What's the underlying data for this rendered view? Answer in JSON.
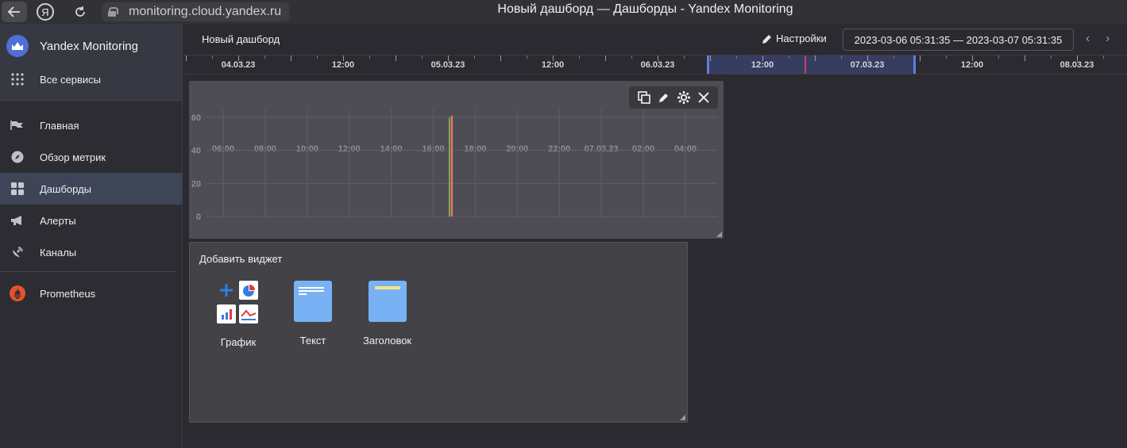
{
  "browser": {
    "url": "monitoring.cloud.yandex.ru",
    "window_title": "Новый дашборд — Дашборды - Yandex Monitoring",
    "ya_label": "Я"
  },
  "sidebar": {
    "app_title": "Yandex Monitoring",
    "all_services": "Все сервисы",
    "items": [
      {
        "label": "Главная",
        "icon": "flag-icon"
      },
      {
        "label": "Обзор метрик",
        "icon": "compass-icon"
      },
      {
        "label": "Дашборды",
        "icon": "dashboard-grid-icon",
        "active": true
      },
      {
        "label": "Алерты",
        "icon": "megaphone-icon"
      },
      {
        "label": "Каналы",
        "icon": "satellite-icon"
      }
    ],
    "prometheus": "Prometheus"
  },
  "header": {
    "dashboard_name": "Новый дашборд",
    "settings_label": "Настройки",
    "time_range": "2023-03-06 05:31:35 — 2023-03-07 05:31:35"
  },
  "timeline": {
    "labels": [
      "04.03.23",
      "12:00",
      "05.03.23",
      "12:00",
      "06.03.23",
      "12:00",
      "07.03.23",
      "12:00",
      "08.03.23"
    ]
  },
  "chart_data": {
    "type": "line",
    "title": "",
    "xlabel": "",
    "ylabel": "",
    "x_ticks": [
      "06:00",
      "08:00",
      "10:00",
      "12:00",
      "14:00",
      "16:00",
      "18:00",
      "20:00",
      "22:00",
      "07.03.23",
      "02:00",
      "04:00"
    ],
    "y_ticks": [
      "0",
      "20",
      "40",
      "60"
    ],
    "ylim": [
      0,
      60
    ],
    "grid": true,
    "series": [
      {
        "color": "#8bc34a",
        "x": [
          "16:46",
          "16:46"
        ],
        "y": [
          0,
          60
        ]
      },
      {
        "color": "#e57373",
        "x": [
          "16:53",
          "16:53"
        ],
        "y": [
          0,
          61
        ]
      }
    ]
  },
  "add_widget": {
    "title": "Добавить виджет",
    "tiles": [
      {
        "label": "График",
        "icon": "chart-widget-icon"
      },
      {
        "label": "Текст",
        "icon": "text-widget-icon"
      },
      {
        "label": "Заголовок",
        "icon": "header-widget-icon"
      }
    ]
  },
  "colors": {
    "accent": "#5d7de0",
    "now_marker": "#c5455a",
    "tile_blue": "#78b2f4",
    "active_sidebar": "#3d4557"
  }
}
